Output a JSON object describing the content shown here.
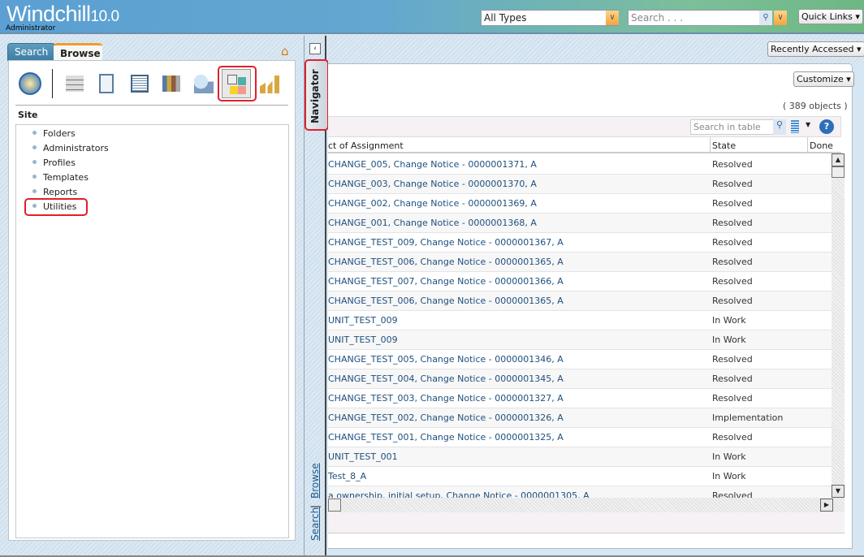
{
  "header": {
    "app_name": "Windchill",
    "version": "10.0",
    "role": "Administrator",
    "type_select": "All Types",
    "search_placeholder": "Search . . .",
    "quick_links": "Quick Links"
  },
  "left": {
    "tabs": [
      {
        "label": "Search"
      },
      {
        "label": "Browse",
        "active": true
      }
    ],
    "section": "Site",
    "tools": [
      "recent-icon",
      "products-icon",
      "projects-icon",
      "libraries-icon",
      "programs-icon",
      "organizations-icon",
      "site-icon",
      "reports-icon"
    ],
    "selected_tool": "site-icon",
    "tree": [
      {
        "label": "Folders"
      },
      {
        "label": "Administrators"
      },
      {
        "label": "Profiles"
      },
      {
        "label": "Templates"
      },
      {
        "label": "Reports"
      },
      {
        "label": "Utilities",
        "highlighted": true
      }
    ]
  },
  "navigator": {
    "title": "Navigator",
    "browse": "Browse",
    "separator": "|",
    "search": "Search"
  },
  "main": {
    "recently_accessed": "Recently Accessed",
    "customize": "Customize",
    "count": "( 389 objects )",
    "table_search_placeholder": "Search in table",
    "columns": [
      "ct of Assignment",
      "State",
      "Done"
    ],
    "rows": [
      {
        "subject": "CHANGE_005, Change Notice - 0000001371, A",
        "state": "Resolved"
      },
      {
        "subject": "CHANGE_003, Change Notice - 0000001370, A",
        "state": "Resolved"
      },
      {
        "subject": "CHANGE_002, Change Notice - 0000001369, A",
        "state": "Resolved"
      },
      {
        "subject": "CHANGE_001, Change Notice - 0000001368, A",
        "state": "Resolved"
      },
      {
        "subject": "CHANGE_TEST_009, Change Notice - 0000001367, A",
        "state": "Resolved"
      },
      {
        "subject": "CHANGE_TEST_006, Change Notice - 0000001365, A",
        "state": "Resolved"
      },
      {
        "subject": "CHANGE_TEST_007, Change Notice - 0000001366, A",
        "state": "Resolved"
      },
      {
        "subject": "CHANGE_TEST_006, Change Notice - 0000001365, A",
        "state": "Resolved"
      },
      {
        "subject": "UNIT_TEST_009",
        "state": "In Work"
      },
      {
        "subject": "UNIT_TEST_009",
        "state": "In Work"
      },
      {
        "subject": "CHANGE_TEST_005, Change Notice - 0000001346, A",
        "state": "Resolved"
      },
      {
        "subject": "CHANGE_TEST_004, Change Notice - 0000001345, A",
        "state": "Resolved"
      },
      {
        "subject": "CHANGE_TEST_003, Change Notice - 0000001327, A",
        "state": "Resolved"
      },
      {
        "subject": "CHANGE_TEST_002, Change Notice - 0000001326, A",
        "state": "Implementation"
      },
      {
        "subject": "CHANGE_TEST_001, Change Notice - 0000001325, A",
        "state": "Resolved"
      },
      {
        "subject": "UNIT_TEST_001",
        "state": "In Work"
      },
      {
        "subject": "Test_8_A",
        "state": "In Work"
      },
      {
        "subject": "a ownership, initial setup, Change Notice - 0000001305, A",
        "state": "Resolved"
      }
    ]
  },
  "colors": {
    "accent_highlight": "#e0202a",
    "link": "#1e4f7e"
  }
}
